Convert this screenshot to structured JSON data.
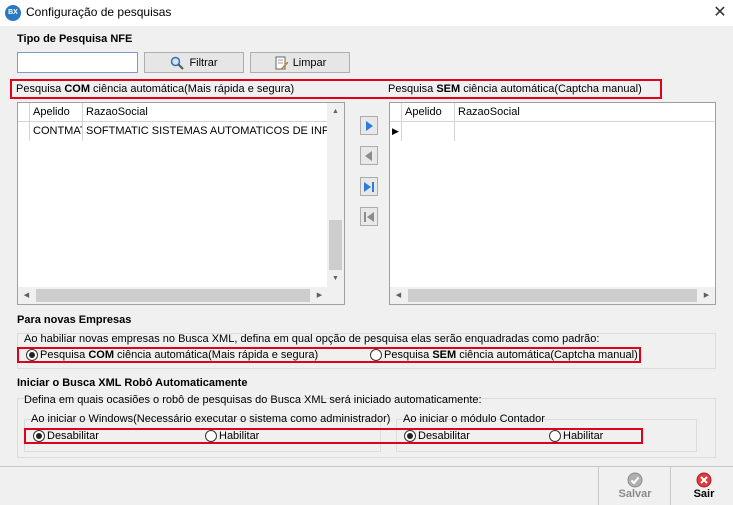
{
  "window": {
    "title": "Configuração de pesquisas",
    "icon_text": "BX"
  },
  "search": {
    "title": "Tipo de Pesquisa NFE",
    "input_value": "",
    "filter_label": "Filtrar",
    "clear_label": "Limpar"
  },
  "left_panel": {
    "label_pre": "Pesquisa ",
    "label_bold": "COM",
    "label_post": " ciência automática(Mais rápida e segura)",
    "columns": [
      "Apelido",
      "RazaoSocial"
    ],
    "rows": [
      {
        "apelido": "CONTMAT",
        "razao": "SOFTMATIC SISTEMAS AUTOMATICOS DE INFO"
      }
    ]
  },
  "right_panel": {
    "label_pre": "Pesquisa ",
    "label_bold": "SEM",
    "label_post": " ciência automática(Captcha manual)",
    "columns": [
      "Apelido",
      "RazaoSocial"
    ],
    "rows": []
  },
  "new_companies": {
    "title": "Para novas Empresas",
    "description": "Ao habiliar novas empresas no Busca XML, defina em qual opção de pesquisa elas serão enquadradas como padrão:",
    "option_com": {
      "pre": "Pesquisa ",
      "bold": "COM",
      "post": " ciência automática(Mais rápida e segura)",
      "checked": true
    },
    "option_sem": {
      "pre": "Pesquisa ",
      "bold": "SEM",
      "post": " ciência automática(Captcha manual)",
      "checked": false
    }
  },
  "auto_start": {
    "title": "Iniciar o Busca XML Robô Automaticamente",
    "description": "Defina em quais ocasiões o robô de pesquisas do Busca XML será iniciado automaticamente:",
    "windows_group": {
      "label": "Ao iniciar o Windows(Necessário executar o sistema como administrador)",
      "disable_label": "Desabilitar",
      "enable_label": "Habilitar",
      "selected": "disable"
    },
    "contador_group": {
      "label": "Ao iniciar o módulo Contador",
      "disable_label": "Desabilitar",
      "enable_label": "Habilitar",
      "selected": "disable"
    }
  },
  "actions": {
    "save_label": "Salvar",
    "exit_label": "Sair"
  },
  "colors": {
    "highlight": "#e0001b",
    "save_icon": "#8c8c8c",
    "exit_icon": "#e03a3a",
    "nav_active": "#2f7bd8",
    "nav_disabled": "#8c8c8c"
  }
}
